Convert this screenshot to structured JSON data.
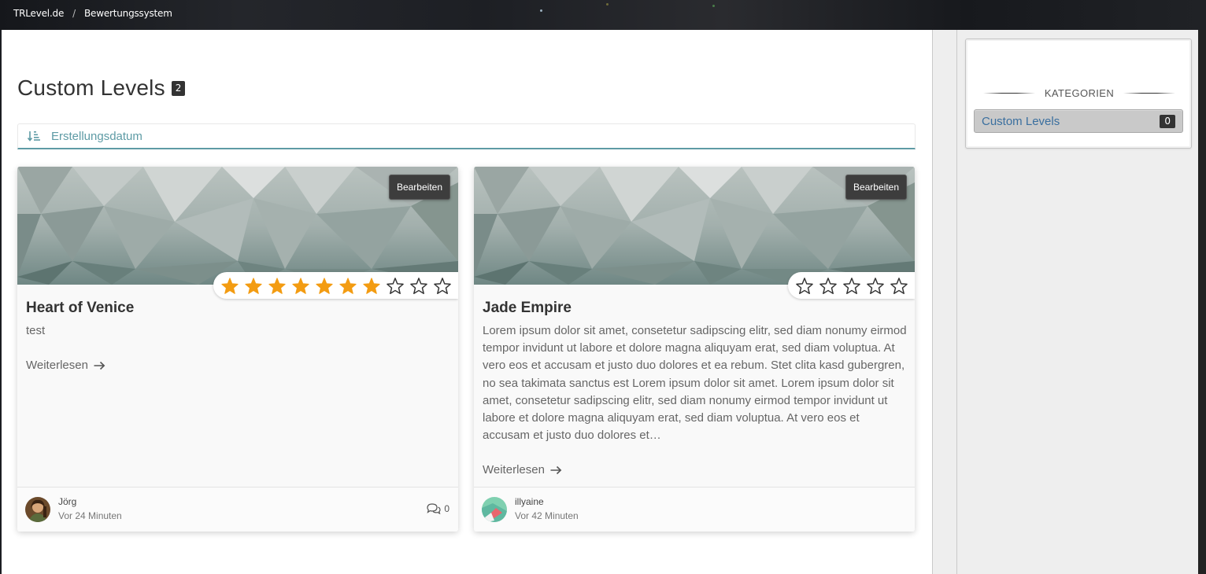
{
  "breadcrumb": {
    "home": "TRLevel.de",
    "separator": "/",
    "current": "Bewertungssystem"
  },
  "page": {
    "title": "Custom Levels",
    "count": "2"
  },
  "sort": {
    "label": "Erstellungsdatum",
    "icon": "sort-amount-down-icon"
  },
  "cards": [
    {
      "title": "Heart of Venice",
      "text": "test",
      "edit_label": "Bearbeiten",
      "rating": 7,
      "max_rating": 10,
      "read_more": "Weiterlesen",
      "author": "Jörg",
      "time": "Vor 24 Minuten",
      "comments": "0"
    },
    {
      "title": "Jade Empire",
      "text": "Lorem ipsum dolor sit amet, consetetur sadipscing elitr, sed diam nonumy eirmod tempor invidunt ut labore et dolore magna aliquyam erat, sed diam voluptua. At vero eos et accusam et justo duo dolores et ea rebum. Stet clita kasd gubergren, no sea takimata sanctus est Lorem ipsum dolor sit amet. Lorem ipsum dolor sit amet, consetetur sadipscing elitr, sed diam nonumy eirmod tempor invidunt ut labore et dolore magna aliquyam erat, sed diam voluptua. At vero eos et accusam et justo duo dolores et…",
      "edit_label": "Bearbeiten",
      "rating": 0,
      "max_rating": 5,
      "read_more": "Weiterlesen",
      "author": "illyaine",
      "time": "Vor 42 Minuten"
    }
  ],
  "sidebar": {
    "heading": "KATEGORIEN",
    "items": [
      {
        "label": "Custom Levels",
        "count": "0"
      }
    ]
  },
  "colors": {
    "accent": "#5e9ba5",
    "star_filled": "#f39c12",
    "link": "#3a6f9f",
    "badge": "#333333"
  }
}
